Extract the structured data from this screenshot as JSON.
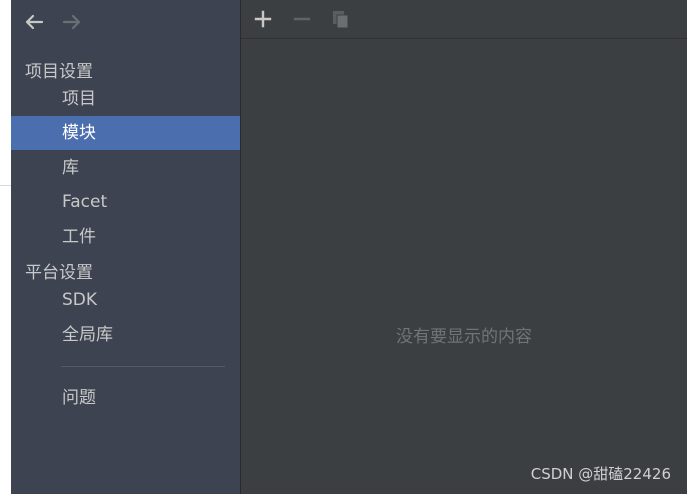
{
  "sidebar": {
    "nav": {
      "back_icon": "arrow-left-icon",
      "forward_icon": "arrow-right-icon"
    },
    "sections": [
      {
        "title": "项目设置",
        "items": [
          {
            "label": "项目",
            "selected": false
          },
          {
            "label": "模块",
            "selected": true
          },
          {
            "label": "库",
            "selected": false
          },
          {
            "label": "Facet",
            "selected": false
          },
          {
            "label": "工件",
            "selected": false
          }
        ]
      },
      {
        "title": "平台设置",
        "items": [
          {
            "label": "SDK",
            "selected": false
          },
          {
            "label": "全局库",
            "selected": false
          }
        ]
      }
    ],
    "extra_items": [
      {
        "label": "问题"
      }
    ]
  },
  "toolbar": {
    "add_icon": "plus-icon",
    "remove_icon": "minus-icon",
    "copy_icon": "copy-icon"
  },
  "main": {
    "empty_text": "没有要显示的内容"
  },
  "watermark": "CSDN @甜磕22426",
  "colors": {
    "sidebar_bg": "#3d4350",
    "selected_bg": "#4b6eaf",
    "main_bg": "#3c3f41"
  }
}
